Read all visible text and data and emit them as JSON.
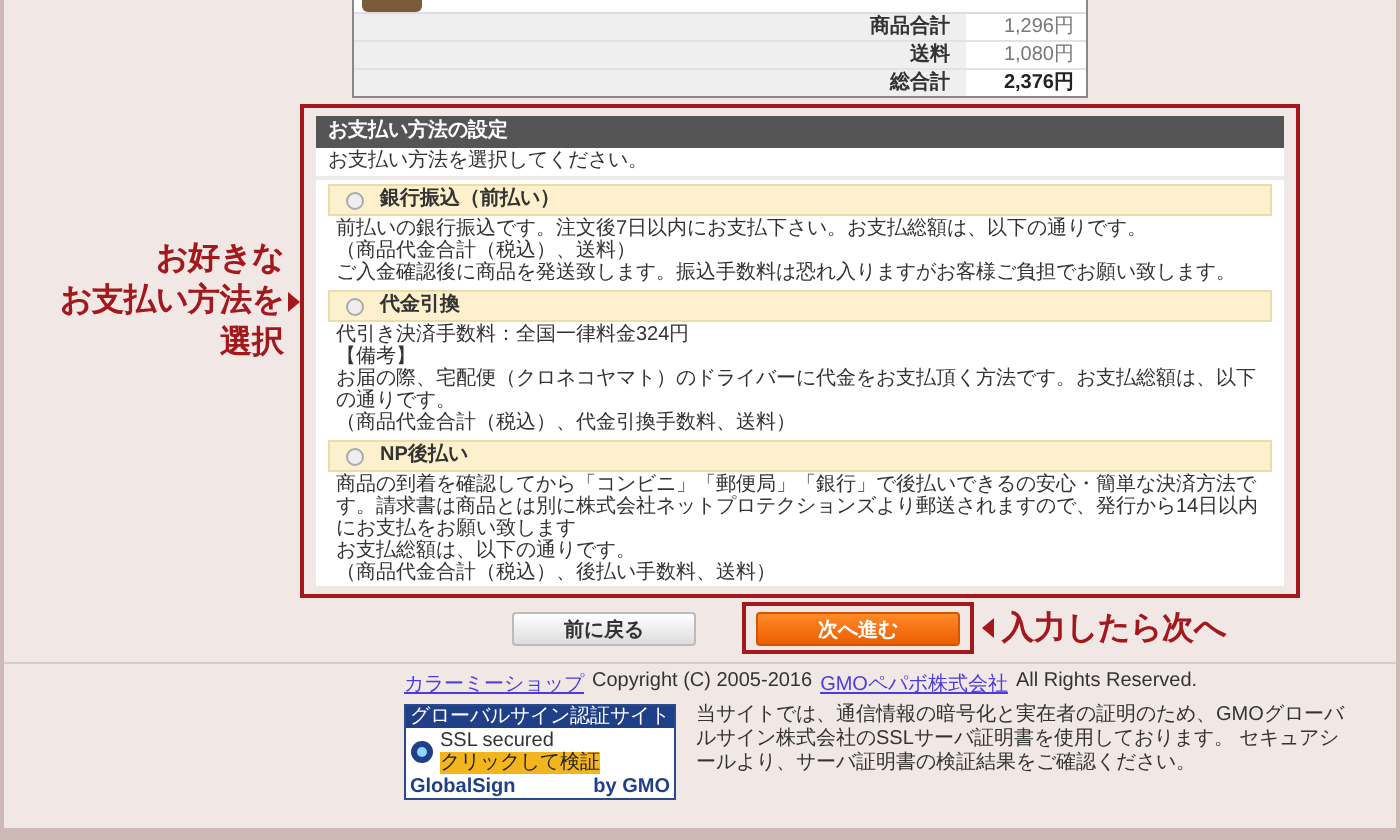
{
  "order_summary": {
    "rows": [
      {
        "label": "商品合計",
        "value": "1,296円",
        "kind": "subtotal"
      },
      {
        "label": "送料",
        "value": "1,080円",
        "kind": "subtotal"
      },
      {
        "label": "総合計",
        "value": "2,376円",
        "kind": "total"
      }
    ]
  },
  "callout_left": {
    "lines": [
      "お好きな",
      "お支払い方法を",
      "選択"
    ]
  },
  "payment_panel": {
    "title": "お支払い方法の設定",
    "instruction": "お支払い方法を選択してください。",
    "methods": [
      {
        "name": "銀行振込（前払い）",
        "selected": false,
        "description": [
          "前払いの銀行振込です。注文後7日以内にお支払下さい。お支払総額は、以下の通りです。",
          "（商品代金合計（税込）、送料）",
          "ご入金確認後に商品を発送致します。振込手数料は恐れ入りますがお客様ご負担でお願い致します。"
        ]
      },
      {
        "name": "代金引換",
        "selected": false,
        "description": [
          "代引き決済手数料：全国一律料金324円",
          "【備考】",
          "お届の際、宅配便（クロネコヤマト）のドライバーに代金をお支払頂く方法です。お支払総額は、以下の通りです。",
          "（商品代金合計（税込）、代金引換手数料、送料）"
        ]
      },
      {
        "name": "NP後払い",
        "selected": false,
        "description": [
          "商品の到着を確認してから「コンビニ」「郵便局」「銀行」で後払いできるの安心・簡単な決済方法です。請求書は商品とは別に株式会社ネットプロテクションズより郵送されますので、発行から14日以内にお支払をお願い致します",
          "お支払総額は、以下の通りです。",
          "（商品代金合計（税込）、後払い手数料、送料）"
        ]
      }
    ]
  },
  "buttons": [
    {
      "label": "前に戻る",
      "kind": "secondary",
      "highlighted": false
    },
    {
      "label": "次へ進む",
      "kind": "primary",
      "highlighted": true
    }
  ],
  "callout_right": "入力したら次へ",
  "footer": {
    "copyright": [
      {
        "text": "カラーミーショップ",
        "kind": "link"
      },
      {
        "text": "Copyright (C) 2005-2016",
        "kind": "text"
      },
      {
        "text": "GMOペパボ株式会社",
        "kind": "link"
      },
      {
        "text": "All Rights Reserved.",
        "kind": "text"
      }
    ],
    "seal": {
      "title": "グローバルサイン認証サイト",
      "badge": "SSL secured",
      "verify": "クリックして検証",
      "brand": "GlobalSign",
      "by": "by GMO"
    },
    "notice": "当サイトでは、通信情報の暗号化と実在者の証明のため、GMOグローバルサイン株式会社のSSLサーバ証明書を使用しております。 セキュアシールより、サーバ証明書の検証結果をご確認ください。"
  }
}
